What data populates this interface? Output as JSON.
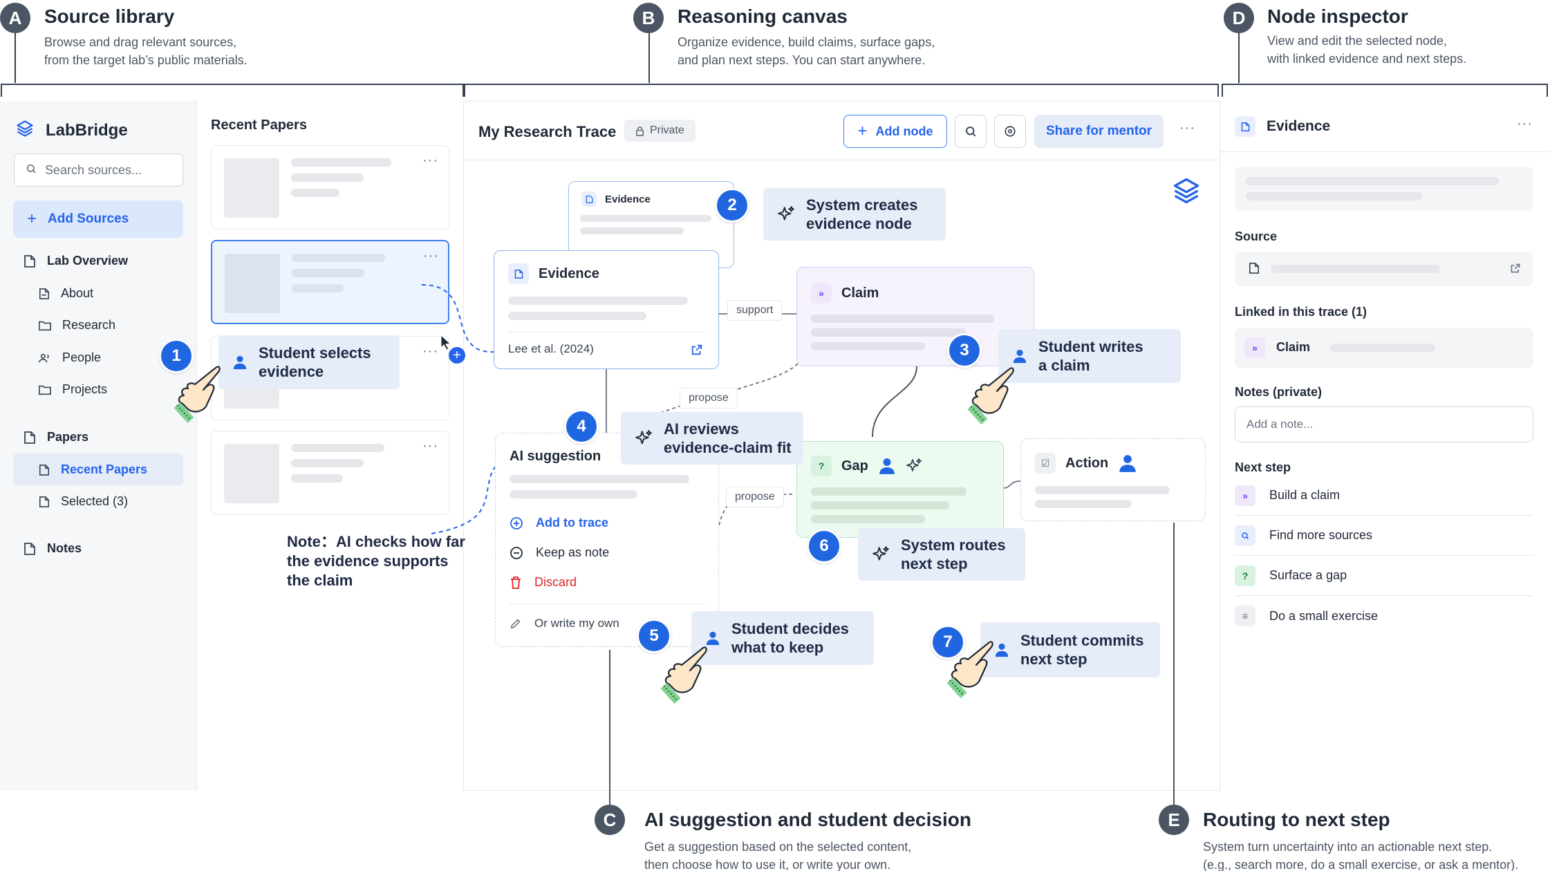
{
  "sections": {
    "a": {
      "badge": "A",
      "title": "Source library",
      "desc1": "Browse and drag relevant sources,",
      "desc2": "from the target lab’s public materials."
    },
    "b": {
      "badge": "B",
      "title": "Reasoning canvas",
      "desc1": "Organize evidence, build claims, surface gaps,",
      "desc2": "and plan next steps. You can start anywhere."
    },
    "c": {
      "badge": "C",
      "title": "AI suggestion and student decision",
      "desc1": "Get a suggestion based on the selected content,",
      "desc2": "then choose how to use it, or write your own."
    },
    "d": {
      "badge": "D",
      "title": "Node inspector",
      "desc1": "View and edit the selected node,",
      "desc2": "with linked evidence and next steps."
    },
    "e": {
      "badge": "E",
      "title": "Routing to next step",
      "desc1": "System turn uncertainty into an actionable next step.",
      "desc2": "(e.g., search more, do a small exercise, or ask a mentor)."
    }
  },
  "sidebar": {
    "app_name": "LabBridge",
    "search_placeholder": "Search sources...",
    "add_sources": "Add Sources",
    "items": [
      {
        "label": "Lab Overview",
        "icon": "file-icon"
      },
      {
        "label": "About",
        "icon": "file-icon"
      },
      {
        "label": "Research",
        "icon": "folder-icon"
      },
      {
        "label": "People",
        "icon": "people-icon"
      },
      {
        "label": "Projects",
        "icon": "folder-icon"
      },
      {
        "label": "Papers",
        "icon": "file-icon"
      },
      {
        "label": "Recent Papers",
        "icon": "file-icon"
      },
      {
        "label": "Selected (3)",
        "icon": "file-icon"
      },
      {
        "label": "Notes",
        "icon": "file-icon"
      }
    ]
  },
  "papers": {
    "title": "Recent Papers",
    "more": "···"
  },
  "canvas": {
    "title": "My Research Trace",
    "private_label": "Private",
    "add_node": "Add node",
    "share": "Share for mentor",
    "more": "···"
  },
  "nodes": {
    "evidence_small": "Evidence",
    "evidence": "Evidence",
    "evidence_citation": "Lee et al. (2024)",
    "claim": "Claim",
    "gap": "Gap",
    "action": "Action",
    "ai_suggestion": "AI suggestion",
    "add_to_trace": "Add to trace",
    "keep_as_note": "Keep as note",
    "discard": "Discard",
    "write_own": "Or write my own"
  },
  "edge_labels": {
    "support": "support",
    "propose1": "propose",
    "propose2": "propose"
  },
  "steps": [
    {
      "num": "1",
      "line1": "Student selects",
      "line2": "evidence"
    },
    {
      "num": "2",
      "line1": "System creates",
      "line2": "evidence node"
    },
    {
      "num": "3",
      "line1": "Student writes",
      "line2": "a claim"
    },
    {
      "num": "4",
      "line1": "AI reviews",
      "line2": "evidence-claim fit"
    },
    {
      "num": "5",
      "line1": "Student decides",
      "line2": "what to keep"
    },
    {
      "num": "6",
      "line1": "System routes",
      "line2": "next step"
    },
    {
      "num": "7",
      "line1": "Student commits",
      "line2": "next step"
    }
  ],
  "note": {
    "line1": "Note：AI checks how far",
    "line2": "the evidence supports",
    "line3": "the claim"
  },
  "inspector": {
    "title": "Evidence",
    "more": "···",
    "source_label": "Source",
    "linked_label": "Linked in this trace (1)",
    "linked_item": "Claim",
    "notes_label": "Notes (private)",
    "notes_placeholder": "Add a note...",
    "next_step_label": "Next step",
    "next_steps": [
      "Build a claim",
      "Find more sources",
      "Surface a gap",
      "Do a small exercise"
    ]
  },
  "colors": {
    "accent": "#2166e1",
    "callout_bg": "#e6edf9",
    "gap_bg": "#ecfaef",
    "claim_bg": "#f6f3fd",
    "discard": "#dc2626"
  }
}
